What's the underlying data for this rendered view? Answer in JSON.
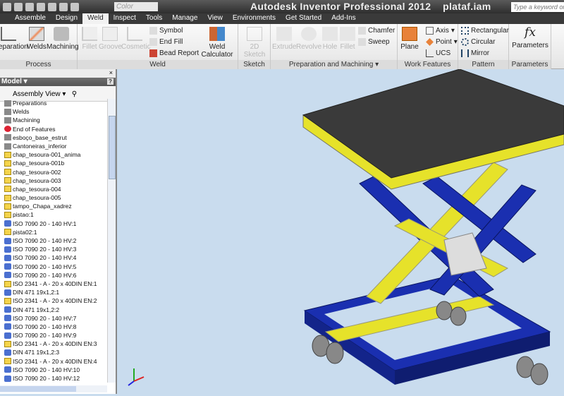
{
  "title": "Autodesk Inventor Professional 2012    plataf.iam",
  "color_field": "Color",
  "search_placeholder": "Type a keyword or phrase",
  "tabs": [
    "Assemble",
    "Design",
    "Weld",
    "Inspect",
    "Tools",
    "Manage",
    "View",
    "Environments",
    "Get Started",
    "Add-Ins"
  ],
  "ribbon": {
    "process": {
      "label": "Process",
      "buttons": [
        "Preparation",
        "Welds",
        "Machining"
      ]
    },
    "weld": {
      "label": "Weld",
      "buttons": [
        "Fillet",
        "Groove",
        "Cosmetic"
      ],
      "small": [
        "Symbol",
        "End Fill",
        "Bead Report"
      ],
      "calc": "Weld Calculator"
    },
    "sketch": {
      "label": "Sketch",
      "buttons": [
        "2D Sketch"
      ]
    },
    "prep": {
      "label": "Preparation and Machining",
      "buttons": [
        "Extrude",
        "Revolve",
        "Hole",
        "Fillet"
      ],
      "small": [
        "Chamfer",
        "Sweep"
      ]
    },
    "work": {
      "label": "Work Features",
      "plane": "Plane",
      "small": [
        "Axis",
        "Point",
        "UCS"
      ]
    },
    "pattern": {
      "label": "Pattern",
      "small": [
        "Rectangular",
        "Circular",
        "Mirror"
      ]
    },
    "params": {
      "label": "Parameters",
      "button": "Parameters"
    }
  },
  "browser": {
    "title": "Model",
    "view": "Assembly View",
    "close": "×",
    "help": "?",
    "items": [
      {
        "t": "Preparations",
        "k": "misc"
      },
      {
        "t": "Welds",
        "k": "misc"
      },
      {
        "t": "Machining",
        "k": "misc"
      },
      {
        "t": "End of Features",
        "k": "end"
      },
      {
        "t": "esboço_base_estrut",
        "k": "misc"
      },
      {
        "t": "Cantoneiras_inferior",
        "k": "misc"
      },
      {
        "t": "chap_tesoura-001_anima",
        "k": "part"
      },
      {
        "t": "chap_tesoura-001b",
        "k": "part"
      },
      {
        "t": "chap_tesoura-002",
        "k": "part"
      },
      {
        "t": "chap_tesoura-003",
        "k": "part"
      },
      {
        "t": "chap_tesoura-004",
        "k": "part"
      },
      {
        "t": "chap_tesoura-005",
        "k": "part"
      },
      {
        "t": "tampo_Chapa_xadrez",
        "k": "part"
      },
      {
        "t": "pistao:1",
        "k": "part"
      },
      {
        "t": "ISO 7090 20 - 140 HV:1",
        "k": "std"
      },
      {
        "t": "pista02:1",
        "k": "part"
      },
      {
        "t": "ISO 7090 20 - 140 HV:2",
        "k": "std"
      },
      {
        "t": "ISO 7090 20 - 140 HV:3",
        "k": "std"
      },
      {
        "t": "ISO 7090 20 - 140 HV:4",
        "k": "std"
      },
      {
        "t": "ISO 7090 20 - 140 HV:5",
        "k": "std"
      },
      {
        "t": "ISO 7090 20 - 140 HV:6",
        "k": "std"
      },
      {
        "t": "ISO 2341 - A - 20 x 40DIN EN:1",
        "k": "part"
      },
      {
        "t": "DIN 471 19x1,2:1",
        "k": "std"
      },
      {
        "t": "ISO 2341 - A - 20 x 40DIN EN:2",
        "k": "part"
      },
      {
        "t": "DIN 471 19x1,2:2",
        "k": "std"
      },
      {
        "t": "ISO 7090 20 - 140 HV:7",
        "k": "std"
      },
      {
        "t": "ISO 7090 20 - 140 HV:8",
        "k": "std"
      },
      {
        "t": "ISO 7090 20 - 140 HV:9",
        "k": "std"
      },
      {
        "t": "ISO 2341 - A - 20 x 40DIN EN:3",
        "k": "part"
      },
      {
        "t": "DIN 471 19x1,2:3",
        "k": "std"
      },
      {
        "t": "ISO 2341 - A - 20 x 40DIN EN:4",
        "k": "part"
      },
      {
        "t": "ISO 7090 20 - 140 HV:10",
        "k": "std"
      },
      {
        "t": "ISO 7090 20 - 140 HV:12",
        "k": "std"
      }
    ]
  },
  "colors": {
    "blue": "#1a2fb0",
    "yellow": "#e6e22a",
    "plate": "#3a3a3a",
    "viewport": "#c9dcee"
  }
}
